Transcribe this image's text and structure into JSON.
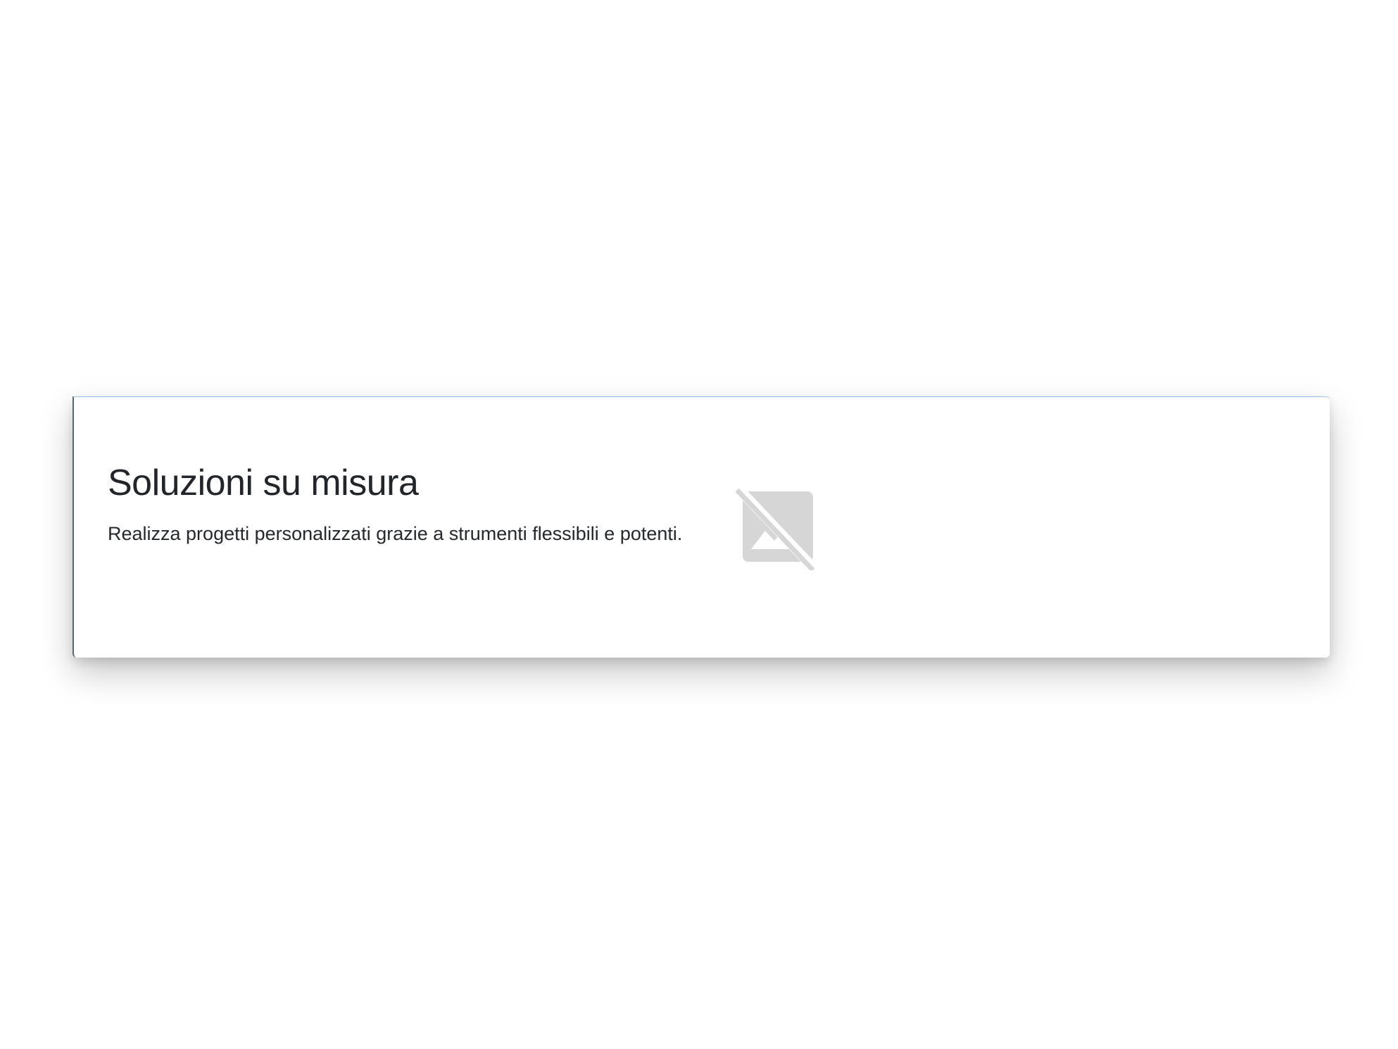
{
  "card": {
    "title": "Soluzioni su misura",
    "description": "Realizza progetti personalizzati grazie a strumenti flessibili e potenti.",
    "image_icon": "broken-image-icon"
  },
  "colors": {
    "title_text": "#22262b",
    "body_text": "#25292d",
    "placeholder_icon": "#d6d6d6",
    "card_top_border": "#9cc0e6",
    "card_left_border": "#5a6570",
    "background": "#ffffff"
  }
}
